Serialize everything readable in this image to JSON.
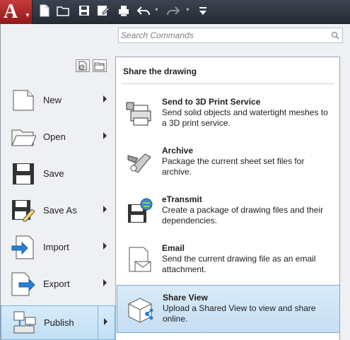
{
  "app": {
    "logo_letter": "A"
  },
  "quick_access": [
    {
      "name": "new-icon"
    },
    {
      "name": "open-icon"
    },
    {
      "name": "save-icon"
    },
    {
      "name": "saveas-icon"
    },
    {
      "name": "print-icon"
    },
    {
      "name": "undo-icon"
    },
    {
      "name": "redo-icon"
    },
    {
      "name": "customize-icon"
    }
  ],
  "search": {
    "placeholder": "Search Commands"
  },
  "left_menu": [
    {
      "label": "New",
      "icon": "new-document-icon",
      "has_submenu": true
    },
    {
      "label": "Open",
      "icon": "folder-icon",
      "has_submenu": true
    },
    {
      "label": "Save",
      "icon": "save-icon",
      "has_submenu": false
    },
    {
      "label": "Save As",
      "icon": "save-as-icon",
      "has_submenu": true
    },
    {
      "label": "Import",
      "icon": "import-icon",
      "has_submenu": true
    },
    {
      "label": "Export",
      "icon": "export-icon",
      "has_submenu": true
    },
    {
      "label": "Publish",
      "icon": "publish-icon",
      "has_submenu": true,
      "active": true
    }
  ],
  "panel": {
    "title": "Share the drawing",
    "items": [
      {
        "title": "Send to 3D Print Service",
        "desc": "Send solid objects and watertight meshes to a 3D print service.",
        "icon": "3d-print-icon"
      },
      {
        "title": "Archive",
        "desc": "Package the current sheet set files for archive.",
        "icon": "archive-icon"
      },
      {
        "title": "eTransmit",
        "desc": "Create a package of drawing files and their dependencies.",
        "icon": "etransmit-icon"
      },
      {
        "title": "Email",
        "desc": "Send the current drawing file as an email attachment.",
        "icon": "email-icon"
      },
      {
        "title": "Share View",
        "desc": "Upload a Shared View to view and share online.",
        "icon": "share-view-icon",
        "active": true
      }
    ]
  },
  "colors": {
    "accent": "#c2dff5",
    "brand_red": "#b22a2a"
  }
}
